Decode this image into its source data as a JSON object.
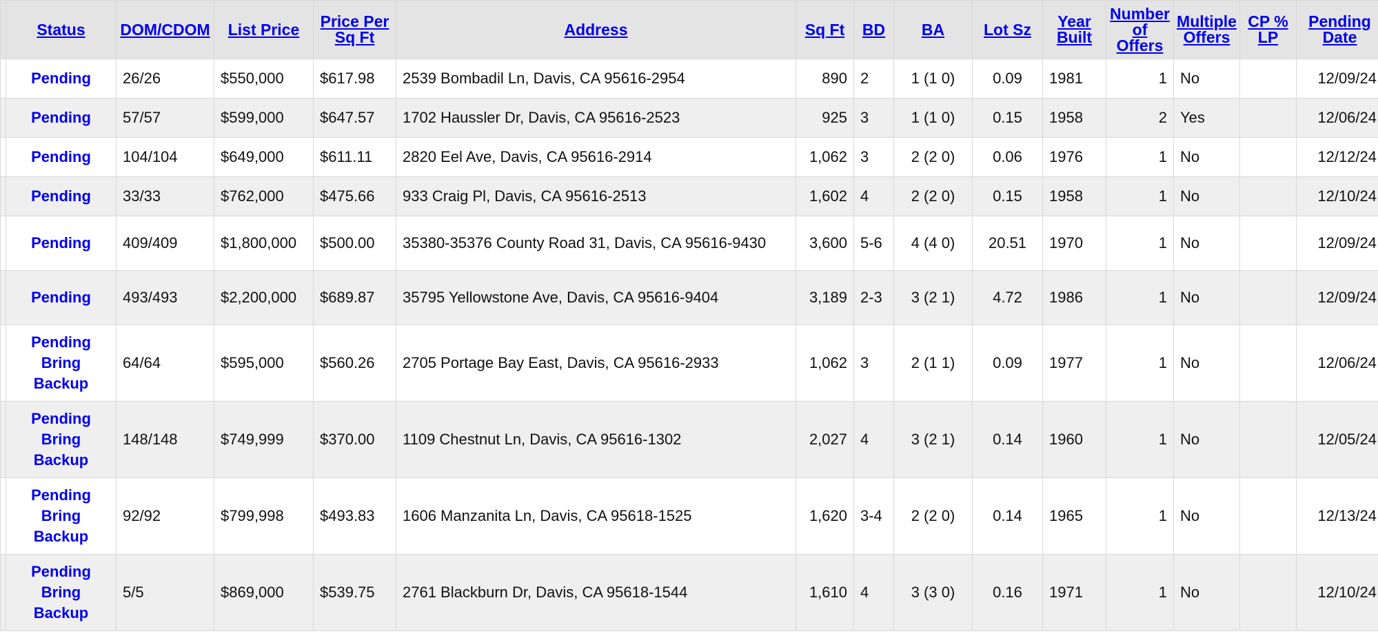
{
  "columns": {
    "status": "Status",
    "dom_cdom": "DOM/CDOM",
    "list_price": "List Price",
    "price_per_sqft": "Price Per Sq Ft",
    "address": "Address",
    "sqft": "Sq Ft",
    "bd": "BD",
    "ba": "BA",
    "lot_sz": "Lot Sz",
    "year_built": "Year Built",
    "num_offers": "Number of Offers",
    "multiple_offers": "Multiple Offers",
    "cp_lp": "CP % LP",
    "pending_date": "Pending Date"
  },
  "rows": [
    {
      "status": "Pending",
      "dom_cdom": "26/26",
      "list_price": "$550,000",
      "price_per_sqft": "$617.98",
      "address": "2539 Bombadil Ln, Davis, CA 95616-2954",
      "sqft": "890",
      "bd": "2",
      "ba": "1 (1 0)",
      "lot_sz": "0.09",
      "year_built": "1981",
      "num_offers": "1",
      "multiple_offers": "No",
      "cp_lp": "",
      "pending_date": "12/09/24"
    },
    {
      "status": "Pending",
      "dom_cdom": "57/57",
      "list_price": "$599,000",
      "price_per_sqft": "$647.57",
      "address": "1702 Haussler Dr, Davis, CA 95616-2523",
      "sqft": "925",
      "bd": "3",
      "ba": "1 (1 0)",
      "lot_sz": "0.15",
      "year_built": "1958",
      "num_offers": "2",
      "multiple_offers": "Yes",
      "cp_lp": "",
      "pending_date": "12/06/24"
    },
    {
      "status": "Pending",
      "dom_cdom": "104/104",
      "list_price": "$649,000",
      "price_per_sqft": "$611.11",
      "address": "2820 Eel Ave, Davis, CA 95616-2914",
      "sqft": "1,062",
      "bd": "3",
      "ba": "2 (2 0)",
      "lot_sz": "0.06",
      "year_built": "1976",
      "num_offers": "1",
      "multiple_offers": "No",
      "cp_lp": "",
      "pending_date": "12/12/24"
    },
    {
      "status": "Pending",
      "dom_cdom": "33/33",
      "list_price": "$762,000",
      "price_per_sqft": "$475.66",
      "address": "933 Craig Pl, Davis, CA 95616-2513",
      "sqft": "1,602",
      "bd": "4",
      "ba": "2 (2 0)",
      "lot_sz": "0.15",
      "year_built": "1958",
      "num_offers": "1",
      "multiple_offers": "No",
      "cp_lp": "",
      "pending_date": "12/10/24"
    },
    {
      "status": "Pending",
      "dom_cdom": "409/409",
      "list_price": "$1,800,000",
      "price_per_sqft": "$500.00",
      "address": "35380-35376 County Road 31, Davis, CA 95616-9430",
      "sqft": "3,600",
      "bd": "5-6",
      "ba": "4 (4 0)",
      "lot_sz": "20.51",
      "year_built": "1970",
      "num_offers": "1",
      "multiple_offers": "No",
      "cp_lp": "",
      "pending_date": "12/09/24"
    },
    {
      "status": "Pending",
      "dom_cdom": "493/493",
      "list_price": "$2,200,000",
      "price_per_sqft": "$689.87",
      "address": "35795 Yellowstone Ave, Davis, CA 95616-9404",
      "sqft": "3,189",
      "bd": "2-3",
      "ba": "3 (2 1)",
      "lot_sz": "4.72",
      "year_built": "1986",
      "num_offers": "1",
      "multiple_offers": "No",
      "cp_lp": "",
      "pending_date": "12/09/24"
    },
    {
      "status": "Pending Bring Backup",
      "dom_cdom": "64/64",
      "list_price": "$595,000",
      "price_per_sqft": "$560.26",
      "address": "2705 Portage Bay East, Davis, CA 95616-2933",
      "sqft": "1,062",
      "bd": "3",
      "ba": "2 (1 1)",
      "lot_sz": "0.09",
      "year_built": "1977",
      "num_offers": "1",
      "multiple_offers": "No",
      "cp_lp": "",
      "pending_date": "12/06/24"
    },
    {
      "status": "Pending Bring Backup",
      "dom_cdom": "148/148",
      "list_price": "$749,999",
      "price_per_sqft": "$370.00",
      "address": "1109 Chestnut Ln, Davis, CA 95616-1302",
      "sqft": "2,027",
      "bd": "4",
      "ba": "3 (2 1)",
      "lot_sz": "0.14",
      "year_built": "1960",
      "num_offers": "1",
      "multiple_offers": "No",
      "cp_lp": "",
      "pending_date": "12/05/24"
    },
    {
      "status": "Pending Bring Backup",
      "dom_cdom": "92/92",
      "list_price": "$799,998",
      "price_per_sqft": "$493.83",
      "address": "1606 Manzanita Ln, Davis, CA 95618-1525",
      "sqft": "1,620",
      "bd": "3-4",
      "ba": "2 (2 0)",
      "lot_sz": "0.14",
      "year_built": "1965",
      "num_offers": "1",
      "multiple_offers": "No",
      "cp_lp": "",
      "pending_date": "12/13/24"
    },
    {
      "status": "Pending Bring Backup",
      "dom_cdom": "5/5",
      "list_price": "$869,000",
      "price_per_sqft": "$539.75",
      "address": "2761 Blackburn Dr, Davis, CA 95618-1544",
      "sqft": "1,610",
      "bd": "4",
      "ba": "3 (3 0)",
      "lot_sz": "0.16",
      "year_built": "1971",
      "num_offers": "1",
      "multiple_offers": "No",
      "cp_lp": "",
      "pending_date": "12/10/24"
    }
  ]
}
